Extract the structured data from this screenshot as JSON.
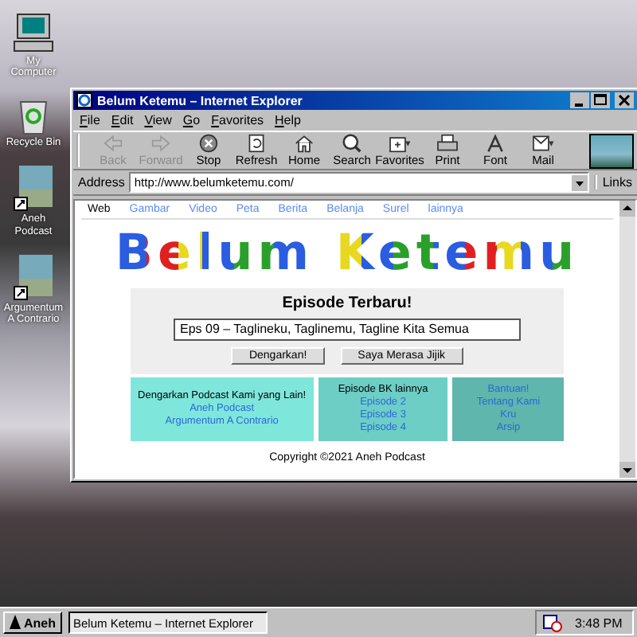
{
  "desktop": {
    "icons": [
      {
        "label": "My Computer",
        "kind": "computer"
      },
      {
        "label": "Recycle Bin",
        "kind": "bin"
      },
      {
        "label": "Aneh Podcast",
        "kind": "shortcut"
      },
      {
        "label": "Argumentum A Contrario",
        "kind": "shortcut"
      }
    ]
  },
  "window": {
    "title": "Belum Ketemu – Internet Explorer",
    "menu": [
      "File",
      "Edit",
      "View",
      "Go",
      "Favorites",
      "Help"
    ],
    "toolbar": [
      {
        "label": "Back",
        "kind": "back",
        "disabled": true
      },
      {
        "label": "Forward",
        "kind": "forward",
        "disabled": true
      },
      {
        "label": "Stop",
        "kind": "stop",
        "disabled": false
      },
      {
        "label": "Refresh",
        "kind": "refresh",
        "disabled": false
      },
      {
        "label": "Home",
        "kind": "home",
        "disabled": false
      },
      {
        "label": "Search",
        "kind": "search",
        "disabled": false
      },
      {
        "label": "Favorites",
        "kind": "favorites",
        "disabled": false
      },
      {
        "label": "Print",
        "kind": "print",
        "disabled": false
      },
      {
        "label": "Font",
        "kind": "font",
        "disabled": false
      },
      {
        "label": "Mail",
        "kind": "mail",
        "disabled": false
      }
    ],
    "address": {
      "label": "Address",
      "value": "http://www.belumketemu.com/",
      "links": "Links"
    }
  },
  "page": {
    "nav": [
      {
        "label": "Web",
        "selected": true
      },
      {
        "label": "Gambar",
        "selected": false
      },
      {
        "label": "Video",
        "selected": false
      },
      {
        "label": "Peta",
        "selected": false
      },
      {
        "label": "Berita",
        "selected": false
      },
      {
        "label": "Belanja",
        "selected": false
      },
      {
        "label": "Surel",
        "selected": false
      },
      {
        "label": "lainnya",
        "selected": false
      }
    ],
    "logo": "Belum Ketemu",
    "heading": "Episode Terbaru!",
    "search_value": "Eps 09 – Taglineku, Taglinemu, Tagline Kita Semua",
    "buttons": [
      "Dengarkan!",
      "Saya Merasa Jijik"
    ],
    "footer_boxes": [
      {
        "title": "Dengarkan Podcast Kami yang Lain!",
        "links": [
          "Aneh Podcast",
          "Argumentum A Contrario"
        ]
      },
      {
        "title": "Episode BK lainnya",
        "links": [
          "Episode 2",
          "Episode 3",
          "Episode 4"
        ]
      },
      {
        "links": [
          "Bantuan!",
          "Tentang Kami",
          "Kru",
          "Arsip"
        ]
      }
    ],
    "copyright": "Copyright ©2021 Aneh Podcast"
  },
  "taskbar": {
    "start": "Aneh",
    "task": "Belum Ketemu – Internet Explorer",
    "clock": "3:48 PM"
  }
}
